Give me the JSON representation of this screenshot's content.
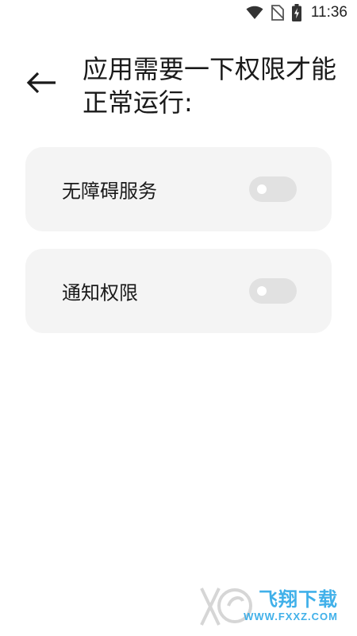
{
  "status_bar": {
    "time": "11:36",
    "icons": [
      "wifi-icon",
      "no-sim-icon",
      "battery-charging-icon"
    ]
  },
  "header": {
    "back_icon": "arrow-left-icon",
    "title": "应用需要一下权限才能正常运行:"
  },
  "permissions": [
    {
      "label": "无障碍服务",
      "enabled": false
    },
    {
      "label": "通知权限",
      "enabled": false
    }
  ],
  "watermark": {
    "brand": "飞翔下载",
    "url": "WWW.FXXZ.COM"
  },
  "colors": {
    "card_bg": "#f4f4f4",
    "toggle_off": "#e1e1e1",
    "text": "#1a1a1a",
    "watermark": "#1fa3e6"
  }
}
